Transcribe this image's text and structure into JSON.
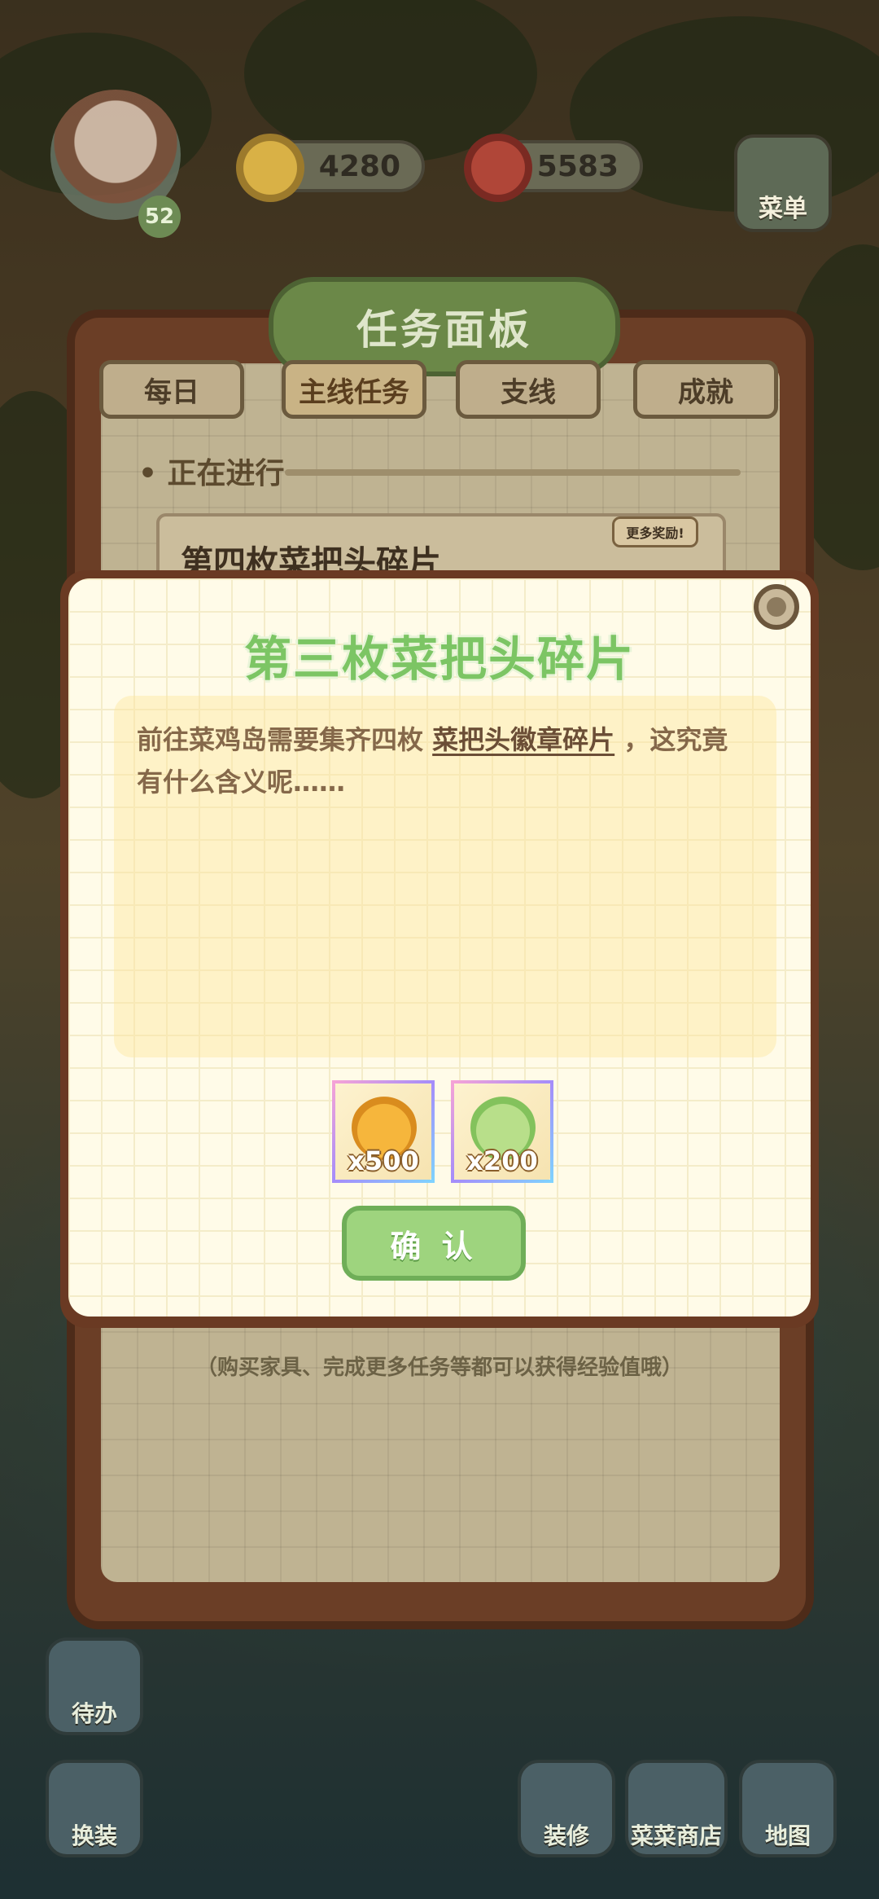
{
  "hud": {
    "level": "52",
    "coins": "4280",
    "gems": "5583",
    "menu_label": "菜单"
  },
  "task_panel": {
    "title": "任务面板",
    "tabs": [
      {
        "label": "每日"
      },
      {
        "label": "主线任务"
      },
      {
        "label": "支线"
      },
      {
        "label": "成就"
      }
    ],
    "section_label": "• 正在进行",
    "current_task": "第四枚菜把头碎片",
    "more_badge": "更多奖励!",
    "hint": "（购买家具、完成更多任务等都可以获得经验值哦）"
  },
  "modal": {
    "title": "第三枚菜把头碎片",
    "desc_part1": "前往菜鸡岛需要集齐四枚 ",
    "desc_highlight": "菜把头徽章碎片",
    "desc_part2": " ，这究竟有什么含义呢……",
    "rewards": [
      {
        "icon": "coin-pile-icon",
        "count": "x500"
      },
      {
        "icon": "exp-leaf-up-icon",
        "count": "x200"
      }
    ],
    "confirm_label": "确 认"
  },
  "bottom": {
    "todo_label": "待办",
    "outfit_label": "换装",
    "decorate_label": "装修",
    "shop_label": "菜菜商店",
    "map_label": "地图"
  },
  "colors": {
    "accent_green": "#7cc564",
    "panel_brown": "#6a3a23",
    "modal_bg": "#fffbe8"
  }
}
